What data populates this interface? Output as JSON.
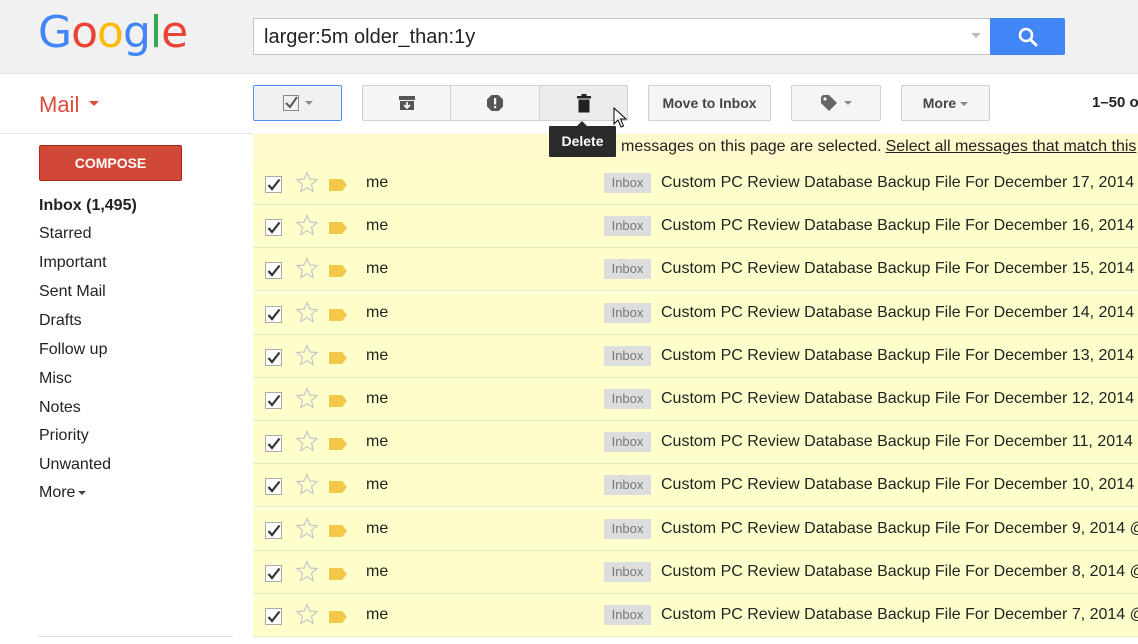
{
  "header": {
    "logo_letters": [
      "G",
      "o",
      "o",
      "g",
      "l",
      "e"
    ],
    "search_value": "larger:5m older_than:1y",
    "search_icon": "search-icon"
  },
  "toolbar": {
    "app_label": "Mail",
    "move_to_inbox": "Move to Inbox",
    "more": "More",
    "pager": "1–50 o",
    "tooltip": "Delete"
  },
  "sidebar": {
    "compose": "COMPOSE",
    "items": [
      {
        "label": "Inbox (1,495)"
      },
      {
        "label": "Starred"
      },
      {
        "label": "Important"
      },
      {
        "label": "Sent Mail"
      },
      {
        "label": "Drafts"
      },
      {
        "label": "Follow up"
      },
      {
        "label": "Misc"
      },
      {
        "label": "Notes"
      },
      {
        "label": "Priority"
      },
      {
        "label": "Unwanted"
      },
      {
        "label": "More"
      }
    ]
  },
  "banner": {
    "text": "messages on this page are selected.",
    "link": "Select all messages that match this"
  },
  "messages": [
    {
      "sender": "me",
      "label": "Inbox",
      "subject": "Custom PC Review Database Backup File For December 17, 2014"
    },
    {
      "sender": "me",
      "label": "Inbox",
      "subject": "Custom PC Review Database Backup File For December 16, 2014"
    },
    {
      "sender": "me",
      "label": "Inbox",
      "subject": "Custom PC Review Database Backup File For December 15, 2014"
    },
    {
      "sender": "me",
      "label": "Inbox",
      "subject": "Custom PC Review Database Backup File For December 14, 2014"
    },
    {
      "sender": "me",
      "label": "Inbox",
      "subject": "Custom PC Review Database Backup File For December 13, 2014"
    },
    {
      "sender": "me",
      "label": "Inbox",
      "subject": "Custom PC Review Database Backup File For December 12, 2014"
    },
    {
      "sender": "me",
      "label": "Inbox",
      "subject": "Custom PC Review Database Backup File For December 11, 2014"
    },
    {
      "sender": "me",
      "label": "Inbox",
      "subject": "Custom PC Review Database Backup File For December 10, 2014"
    },
    {
      "sender": "me",
      "label": "Inbox",
      "subject": "Custom PC Review Database Backup File For December 9, 2014 @"
    },
    {
      "sender": "me",
      "label": "Inbox",
      "subject": "Custom PC Review Database Backup File For December 8, 2014 @"
    },
    {
      "sender": "me",
      "label": "Inbox",
      "subject": "Custom PC Review Database Backup File For December 7, 2014 @"
    }
  ],
  "colors": {
    "accent_red": "#dd4b39",
    "search_blue": "#4285f4",
    "row_selected": "#ffffcc",
    "tag_yellow": "#f3c846"
  }
}
